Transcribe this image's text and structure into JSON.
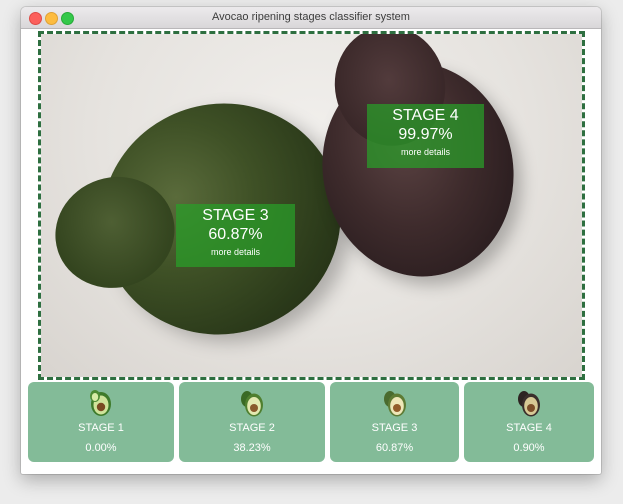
{
  "window": {
    "title": "Avocao ripening stages classifier system"
  },
  "detections": [
    {
      "stage": "STAGE 3",
      "percent": "60.87%",
      "link": "more details"
    },
    {
      "stage": "STAGE 4",
      "percent": "99.97%",
      "link": "more details"
    }
  ],
  "cards": [
    {
      "stage": "STAGE 1",
      "percent": "0.00%",
      "icon": "avocado-stage1-icon"
    },
    {
      "stage": "STAGE 2",
      "percent": "38.23%",
      "icon": "avocado-stage2-icon"
    },
    {
      "stage": "STAGE 3",
      "percent": "60.87%",
      "icon": "avocado-stage3-icon"
    },
    {
      "stage": "STAGE 4",
      "percent": "0.90%",
      "icon": "avocado-stage4-icon"
    }
  ],
  "colors": {
    "card_bg": "#83bb98",
    "detection_bg": "rgba(40,160,40,0.72)",
    "frame_border": "#2e6f40"
  }
}
